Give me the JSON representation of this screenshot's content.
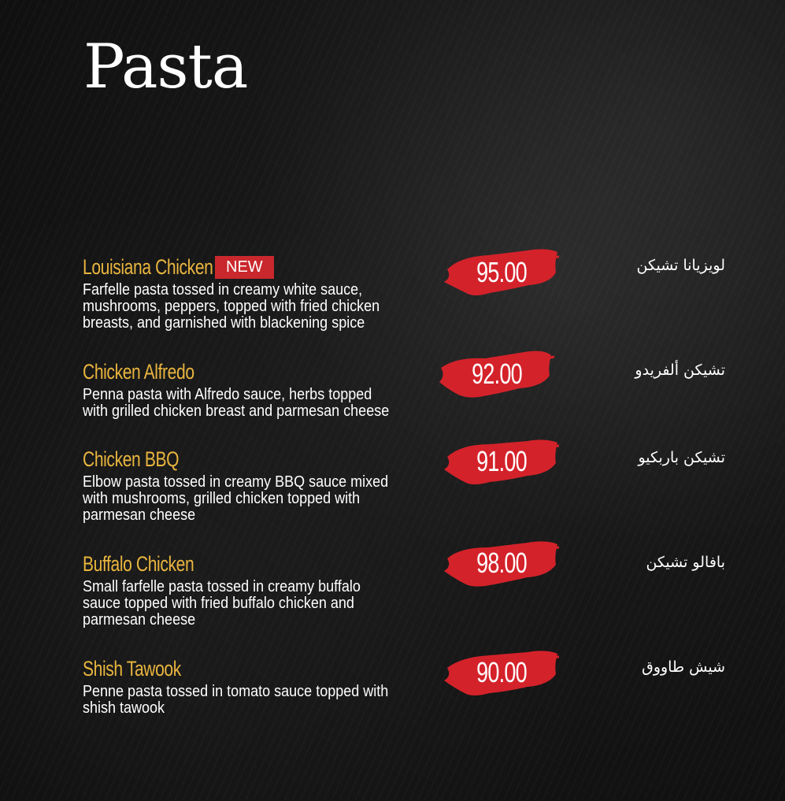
{
  "title": "Pasta",
  "colors": {
    "name": "#e9b53f",
    "accent": "#c9282d",
    "text": "#ffffff",
    "background": "#141414"
  },
  "items": [
    {
      "name": "Louisiana Chicken",
      "badge": "NEW",
      "description": "Farfelle pasta tossed in creamy white sauce,\nmushrooms, peppers, topped with fried chicken\nbreasts, and garnished with blackening spice",
      "price": "95.00",
      "arabic": "لويزيانا تشيكن"
    },
    {
      "name": "Chicken Alfredo",
      "description": "Penna pasta with Alfredo sauce, herbs topped\nwith grilled chicken breast and parmesan cheese",
      "price": "92.00",
      "arabic": "تشيكن ألفريدو"
    },
    {
      "name": "Chicken BBQ",
      "description": "Elbow pasta tossed in creamy BBQ sauce mixed\nwith mushrooms, grilled chicken topped with\nparmesan cheese",
      "price": "91.00",
      "arabic": "تشيكن باربكيو"
    },
    {
      "name": "Buffalo Chicken",
      "description": "Small farfelle pasta tossed in creamy buffalo\nsauce topped with fried buffalo chicken and\nparmesan cheese",
      "price": "98.00",
      "arabic": "بافالو تشيكن"
    },
    {
      "name": "Shish Tawook",
      "description": "Penne pasta tossed in tomato sauce topped with\nshish tawook",
      "price": "90.00",
      "arabic": "شيش طاووق"
    }
  ]
}
